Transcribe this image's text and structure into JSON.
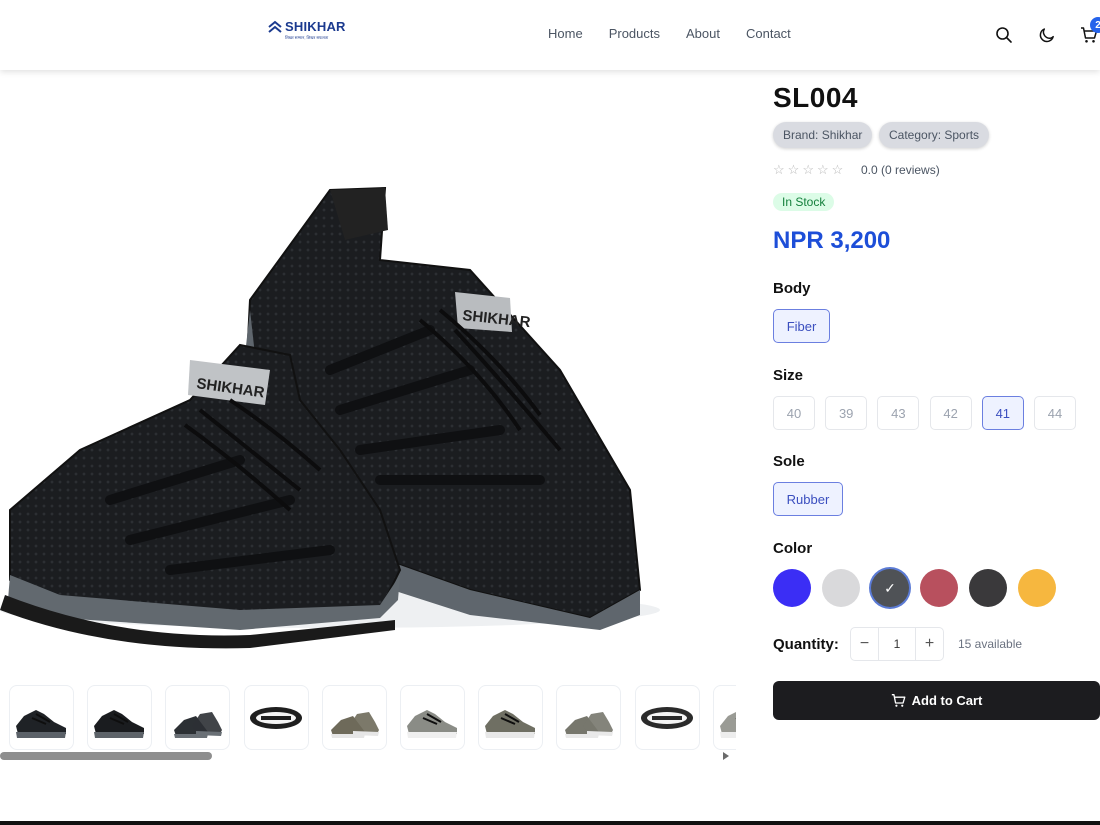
{
  "header": {
    "logo_name": "SHIKHAR",
    "logo_tagline": "शिखर सम्मान, शिखर सफलता",
    "nav": [
      "Home",
      "Products",
      "About",
      "Contact"
    ],
    "cart_count": "2"
  },
  "product": {
    "title": "SL004",
    "brand_chip": "Brand: Shikhar",
    "category_chip": "Category: Sports",
    "rating_text": "0.0 (0 reviews)",
    "stars_filled": 0,
    "stars_total": 5,
    "stock": "In Stock",
    "price": "NPR 3,200",
    "image_label": "SHIKHAR"
  },
  "options": {
    "body_label": "Body",
    "body": [
      {
        "label": "Fiber",
        "selected": true
      }
    ],
    "size_label": "Size",
    "sizes": [
      {
        "label": "40",
        "selected": false
      },
      {
        "label": "39",
        "selected": false
      },
      {
        "label": "43",
        "selected": false
      },
      {
        "label": "42",
        "selected": false
      },
      {
        "label": "41",
        "selected": true
      },
      {
        "label": "44",
        "selected": false
      }
    ],
    "sole_label": "Sole",
    "sole": [
      {
        "label": "Rubber",
        "selected": true
      }
    ],
    "color_label": "Color",
    "colors": [
      {
        "hex": "#3b2ef5",
        "selected": false
      },
      {
        "hex": "#d9d9db",
        "selected": false
      },
      {
        "hex": "#4f5256",
        "selected": true
      },
      {
        "hex": "#b8505e",
        "selected": false
      },
      {
        "hex": "#3a393b",
        "selected": false
      },
      {
        "hex": "#f6b73f",
        "selected": false
      }
    ]
  },
  "quantity": {
    "label": "Quantity:",
    "minus": "−",
    "value": "1",
    "plus": "+",
    "available": "15 available"
  },
  "add_to_cart": "Add to Cart",
  "thumbnails": [
    {
      "view": "side",
      "upper": "#1f2226",
      "sole": "#5b6168"
    },
    {
      "view": "side",
      "upper": "#1a1c1f",
      "sole": "#5d6369"
    },
    {
      "view": "pair",
      "upper": "#2c3034",
      "sole": "#6a7076"
    },
    {
      "view": "sole",
      "upper": "#1e1e1e",
      "sole": "#1e1e1e"
    },
    {
      "view": "pair",
      "upper": "#6e6a5a",
      "sole": "#e6e6e6"
    },
    {
      "view": "side",
      "upper": "#8a8c86",
      "sole": "#efefef"
    },
    {
      "view": "side",
      "upper": "#6f6f63",
      "sole": "#e8e8e8"
    },
    {
      "view": "pair",
      "upper": "#77776d",
      "sole": "#e9e9e9"
    },
    {
      "view": "sole",
      "upper": "#2a2a2a",
      "sole": "#2a2a2a"
    },
    {
      "view": "side",
      "upper": "#9a9b95",
      "sole": "#ededed"
    }
  ]
}
